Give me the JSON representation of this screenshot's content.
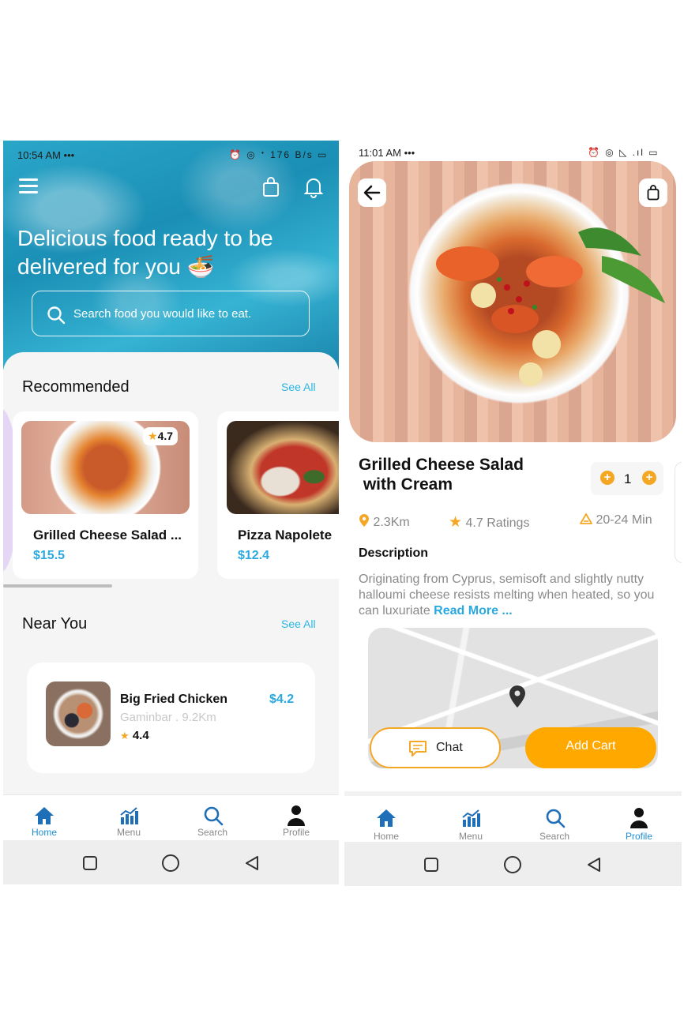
{
  "left": {
    "status": {
      "time": "10:54 AM •••",
      "icons": "⏰ ◎ ᐩ 176 B/s ▭"
    },
    "hero": {
      "title": "Delicious food ready to be delivered for you 🍜"
    },
    "search": {
      "placeholder": "Search food you would like to eat."
    },
    "recommended": {
      "title": "Recommended",
      "see_all": "See All",
      "items": [
        {
          "name": "Grilled Cheese Salad ...",
          "price": "$15.5",
          "rating": "4.7"
        },
        {
          "name": "Pizza Napolete",
          "price": "$12.4"
        }
      ]
    },
    "near_you": {
      "title": "Near You",
      "see_all": "See All",
      "items": [
        {
          "name": "Big Fried Chicken",
          "location": "Gaminbar . 9.2Km",
          "rating": "4.4",
          "price": "$4.2"
        }
      ]
    },
    "nav": [
      {
        "label": "Home",
        "icon": "home-icon",
        "active": true
      },
      {
        "label": "Menu",
        "icon": "chart-icon"
      },
      {
        "label": "Search",
        "icon": "search-icon"
      },
      {
        "label": "Profile",
        "icon": "profile-icon"
      }
    ]
  },
  "right": {
    "status": {
      "time": "11:01 AM •••",
      "icons": "⏰ ◎ ◺ .ıl ▭"
    },
    "product": {
      "title_line1": "Grilled Cheese Salad",
      "title_line2": " with Cream",
      "quantity": "1",
      "distance": "2.3Km",
      "ratings": "4.7 Ratings",
      "time": "20-24 Min"
    },
    "description": {
      "heading": "Description",
      "text": "Originating from Cyprus, semisoft and slightly nutty halloumi cheese resists melting when heated, so you can luxuriate ",
      "read_more": "Read More ..."
    },
    "actions": {
      "chat": "Chat",
      "add_cart": "Add Cart"
    },
    "nav": [
      {
        "label": "Home",
        "icon": "home-icon"
      },
      {
        "label": "Menu",
        "icon": "chart-icon"
      },
      {
        "label": "Search",
        "icon": "search-icon"
      },
      {
        "label": "Profile",
        "icon": "profile-icon",
        "active": true
      }
    ]
  },
  "colors": {
    "accent": "#29a9e0",
    "orange": "#ffa800",
    "nav_active": "#1e8fd6"
  }
}
